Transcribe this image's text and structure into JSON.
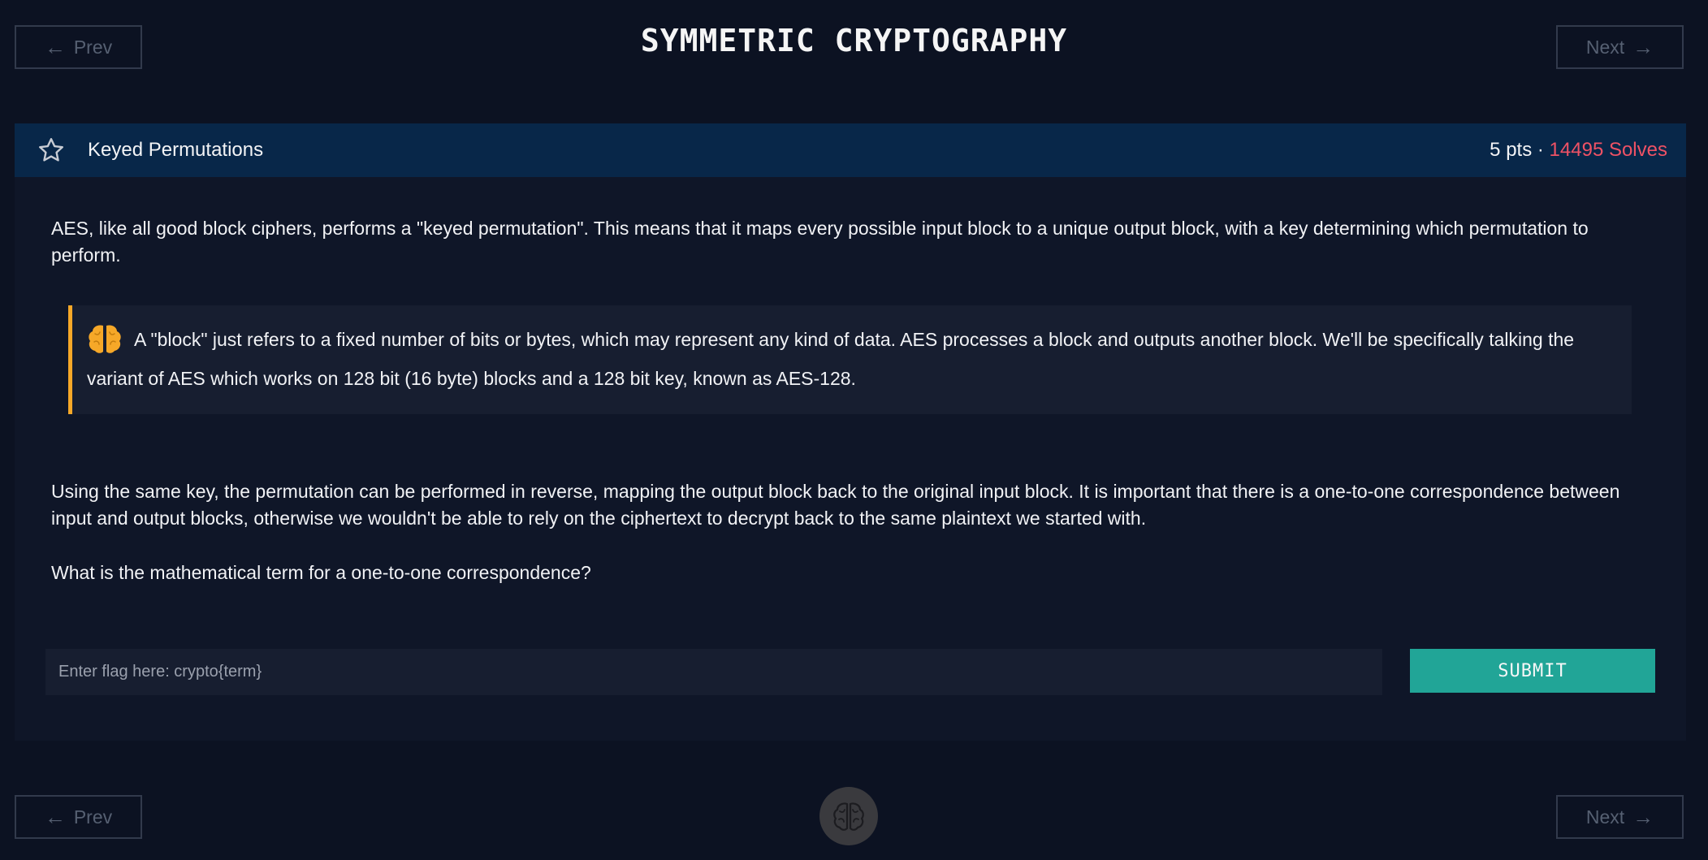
{
  "nav": {
    "prev_label": "Prev",
    "next_label": "Next",
    "prev_arrow": "←",
    "next_arrow": "→"
  },
  "page_title": "SYMMETRIC CRYPTOGRAPHY",
  "challenge": {
    "title": "Keyed Permutations",
    "points": "5 pts",
    "separator": "·",
    "solves": "14495 Solves",
    "favorite_icon": "star-icon",
    "paragraph_1": "AES, like all good block ciphers, performs a \"keyed permutation\". This means that it maps every possible input block to a unique output block, with a key determining which permutation to perform.",
    "callout_icon": "brain-icon",
    "callout_text": "A \"block\" just refers to a fixed number of bits or bytes, which may represent any kind of data. AES processes a block and outputs another block. We'll be specifically talking the variant of AES which works on 128 bit (16 byte) blocks and a 128 bit key, known as AES-128.",
    "paragraph_2": "Using the same key, the permutation can be performed in reverse, mapping the output block back to the original input block. It is important that there is a one-to-one correspondence between input and output blocks, otherwise we wouldn't be able to rely on the ciphertext to decrypt back to the same plaintext we started with.",
    "paragraph_3": "What is the mathematical term for a one-to-one correspondence?"
  },
  "flag_form": {
    "placeholder": "Enter flag here: crypto{term}",
    "value": "",
    "submit_label": "SUBMIT"
  },
  "footer": {
    "logo_icon": "brain-logo-icon"
  },
  "colors": {
    "background": "#0c1222",
    "header_bar": "#082749",
    "solves": "#ef5265",
    "callout_border": "#f6a828",
    "submit": "#21a597"
  }
}
